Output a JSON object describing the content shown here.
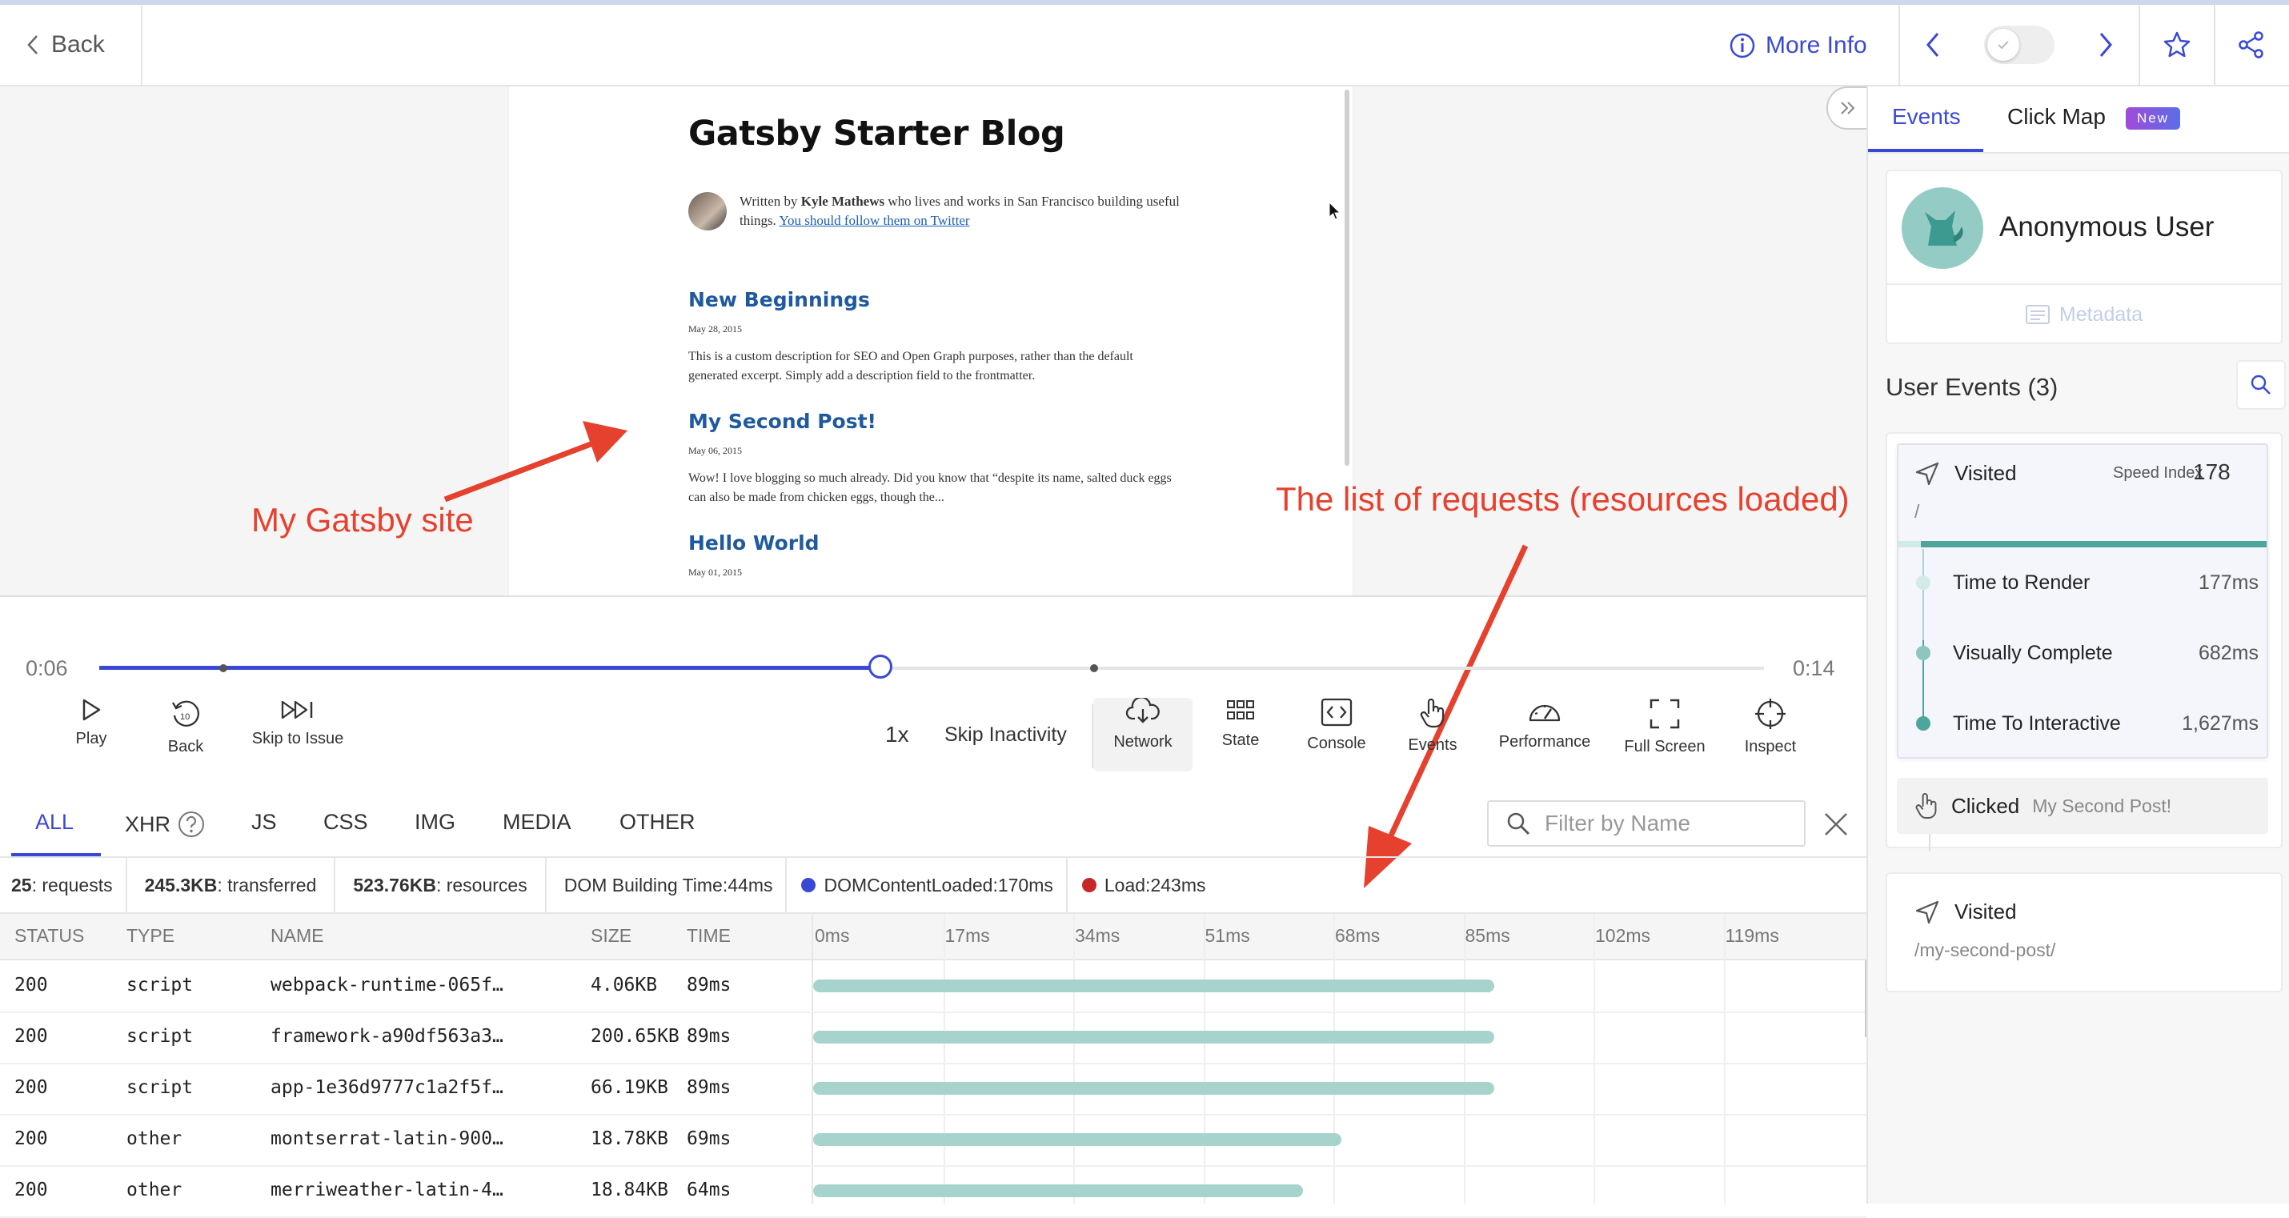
{
  "topbar": {
    "back_label": "Back",
    "more_info_label": "More Info"
  },
  "page_preview": {
    "blog_title": "Gatsby Starter Blog",
    "bio_prefix": "Written by ",
    "bio_author": "Kyle Mathews",
    "bio_middle": " who lives and works in San Francisco building useful things. ",
    "bio_link": "You should follow them on Twitter",
    "posts": [
      {
        "title": "New Beginnings",
        "date": "May 28, 2015",
        "desc": "This is a custom description for SEO and Open Graph purposes, rather than the default generated excerpt. Simply add a description field to the frontmatter."
      },
      {
        "title": "My Second Post!",
        "date": "May 06, 2015",
        "desc": "Wow! I love blogging so much already. Did you know that “despite its name, salted duck eggs can also be made from chicken eggs, though the..."
      },
      {
        "title": "Hello World",
        "date": "May 01, 2015",
        "desc": ""
      }
    ]
  },
  "annotations": {
    "gatsby_site": "My Gatsby site",
    "requests_list": "The list of requests (resources loaded)"
  },
  "timeline": {
    "current": "0:06",
    "total": "0:14",
    "progress_fraction": 0.469
  },
  "controls": {
    "play": "Play",
    "back": "Back",
    "skip_to_issue": "Skip to Issue",
    "speed": "1x",
    "skip_inactivity": "Skip Inactivity",
    "tools": [
      "Network",
      "State",
      "Console",
      "Events",
      "Performance",
      "Full Screen",
      "Inspect"
    ]
  },
  "network": {
    "tabs": [
      "ALL",
      "XHR",
      "JS",
      "CSS",
      "IMG",
      "MEDIA",
      "OTHER"
    ],
    "active_tab": "ALL",
    "filter_placeholder": "Filter by Name",
    "summary": {
      "requests_val": "25",
      "requests_label": ": requests",
      "transferred_val": "245.3KB",
      "transferred_label": ": transferred",
      "resources_val": "523.76KB",
      "resources_label": ": resources",
      "dom_label": "DOM Building Time: ",
      "dom_val": "44ms",
      "dcl_label": "DOMContentLoaded: ",
      "dcl_val": "170ms",
      "load_label": "Load: ",
      "load_val": "243ms"
    },
    "columns": [
      "STATUS",
      "TYPE",
      "NAME",
      "SIZE",
      "TIME"
    ],
    "time_ticks": [
      "0ms",
      "17ms",
      "34ms",
      "51ms",
      "68ms",
      "85ms",
      "102ms",
      "119ms"
    ],
    "rows": [
      {
        "status": "200",
        "type": "script",
        "name": "webpack-runtime-065f…",
        "size": "4.06KB",
        "time": "89ms",
        "duration_ms": 89
      },
      {
        "status": "200",
        "type": "script",
        "name": "framework-a90df563a3…",
        "size": "200.65KB",
        "time": "89ms",
        "duration_ms": 89
      },
      {
        "status": "200",
        "type": "script",
        "name": "app-1e36d9777c1a2f5f…",
        "size": "66.19KB",
        "time": "89ms",
        "duration_ms": 89
      },
      {
        "status": "200",
        "type": "other",
        "name": "montserrat-latin-900…",
        "size": "18.78KB",
        "time": "69ms",
        "duration_ms": 69
      },
      {
        "status": "200",
        "type": "other",
        "name": "merriweather-latin-4…",
        "size": "18.84KB",
        "time": "64ms",
        "duration_ms": 64
      }
    ],
    "colors": {
      "dcl": "#3949d6",
      "load": "#c62828",
      "bar": "#a6d3cc"
    }
  },
  "right_panel": {
    "tab_events": "Events",
    "tab_clickmap": "Click Map",
    "new_badge": "New",
    "user_name": "Anonymous User",
    "metadata_label": "Metadata",
    "user_events_title": "User Events (3)",
    "visited1": {
      "label": "Visited",
      "speed_index_label": "Speed Index",
      "speed_index_val": "178",
      "path": "/",
      "metrics": [
        {
          "label": "Time to Render",
          "value": "177ms"
        },
        {
          "label": "Visually Complete",
          "value": "682ms"
        },
        {
          "label": "Time To Interactive",
          "value": "1,627ms"
        }
      ]
    },
    "clicked": {
      "label": "Clicked",
      "target": "My Second Post!"
    },
    "visited2": {
      "label": "Visited",
      "path": "/my-second-post/"
    }
  }
}
